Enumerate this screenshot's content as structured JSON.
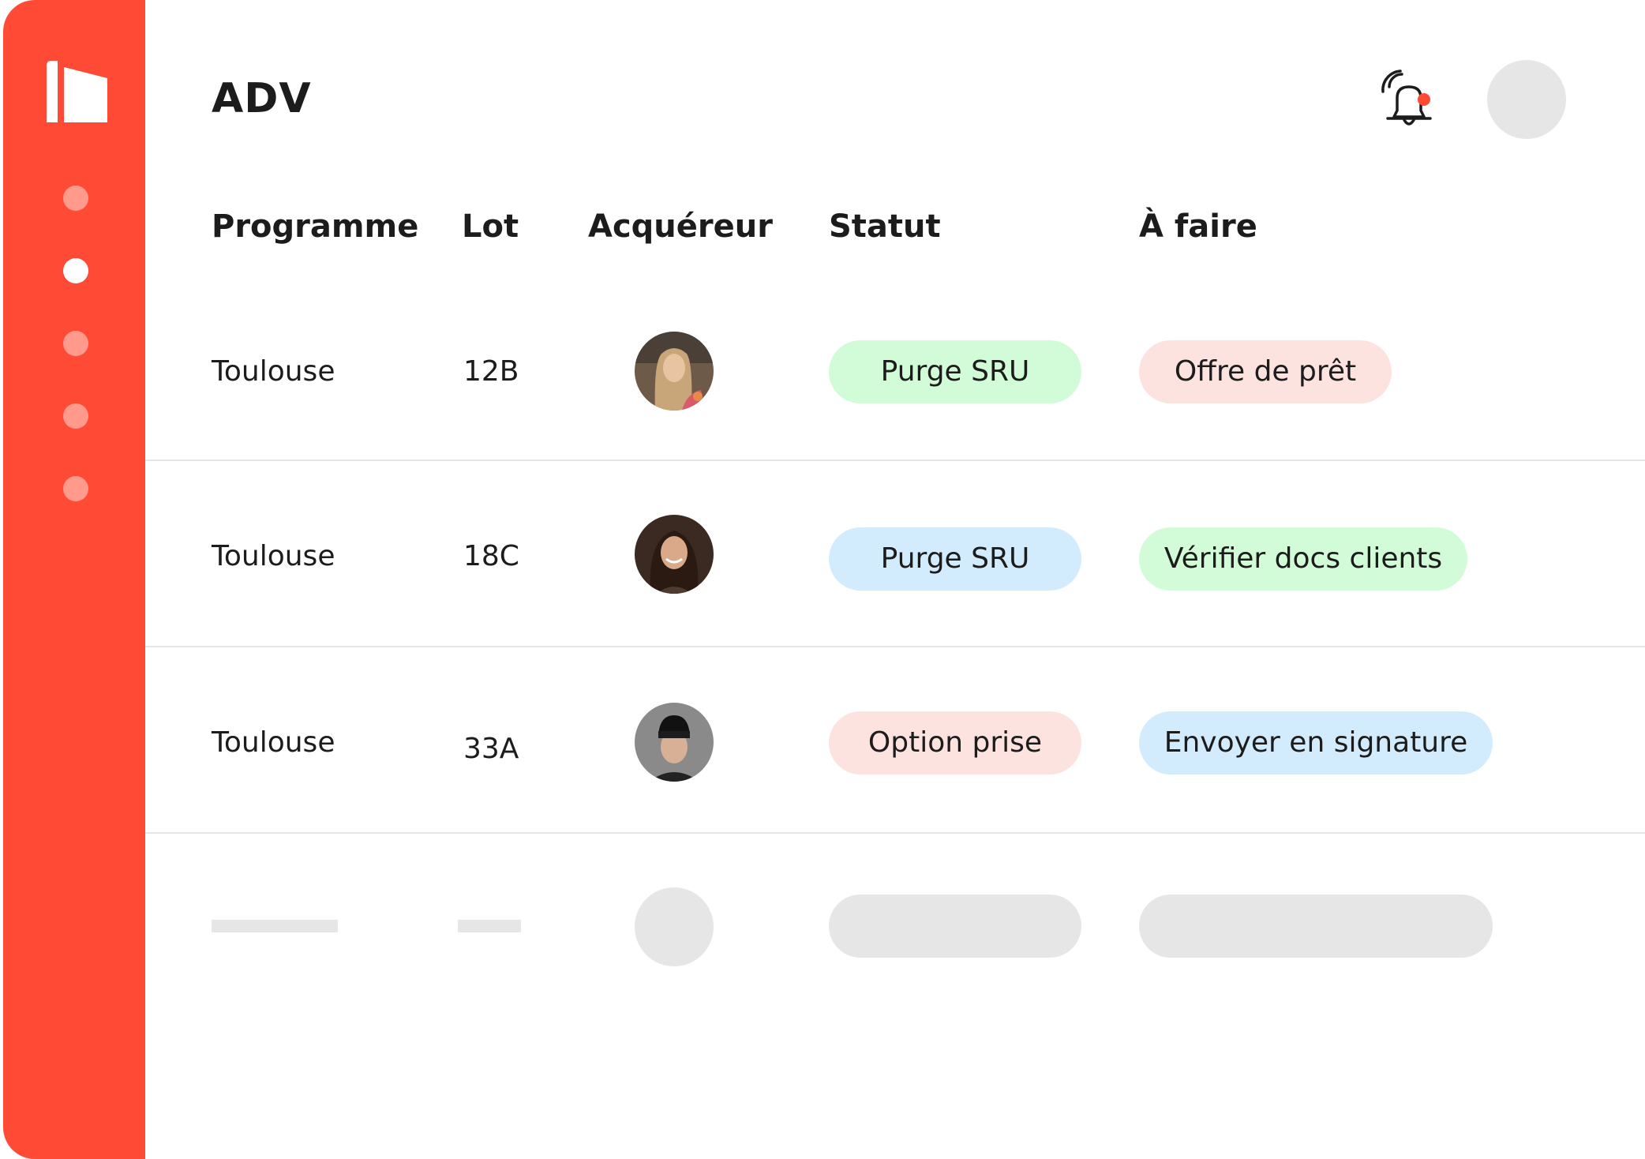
{
  "colors": {
    "brand": "#ff4b36",
    "nav_dot": "#ff9a8d",
    "pill_green": "#d2fcd8",
    "pill_blue": "#d3ecfd",
    "pill_pink": "#fde3df",
    "skeleton": "#e6e6e6",
    "notification_dot": "#ff4b36"
  },
  "sidebar": {
    "logo_icon": "building-logo-icon",
    "items": [
      {
        "icon": "nav-dot",
        "active": false
      },
      {
        "icon": "nav-dot",
        "active": true
      },
      {
        "icon": "nav-dot",
        "active": false
      },
      {
        "icon": "nav-dot",
        "active": false
      },
      {
        "icon": "nav-dot",
        "active": false
      }
    ]
  },
  "header": {
    "title": "ADV",
    "notification_icon": "bell-ringing-icon",
    "has_notification": true,
    "user_avatar": "avatar-placeholder"
  },
  "table": {
    "columns": [
      "Programme",
      "Lot",
      "Acquéreur",
      "Statut",
      "À faire"
    ],
    "rows": [
      {
        "programme": "Toulouse",
        "lot": "12B",
        "acquereur": "buyer-photo-woman-long-hair",
        "statut": {
          "label": "Purge SRU",
          "color": "green"
        },
        "a_faire": {
          "label": "Offre de prêt",
          "color": "pink"
        }
      },
      {
        "programme": "Toulouse",
        "lot": "18C",
        "acquereur": "buyer-photo-woman-smiling",
        "statut": {
          "label": "Purge SRU",
          "color": "blue"
        },
        "a_faire": {
          "label": "Vérifier docs clients",
          "color": "green"
        }
      },
      {
        "programme": "Toulouse",
        "lot": "33A",
        "acquereur": "buyer-photo-man-beanie",
        "statut": {
          "label": "Option prise",
          "color": "pink"
        },
        "a_faire": {
          "label": "Envoyer en signature",
          "color": "blue"
        }
      }
    ],
    "loading_row": true
  }
}
